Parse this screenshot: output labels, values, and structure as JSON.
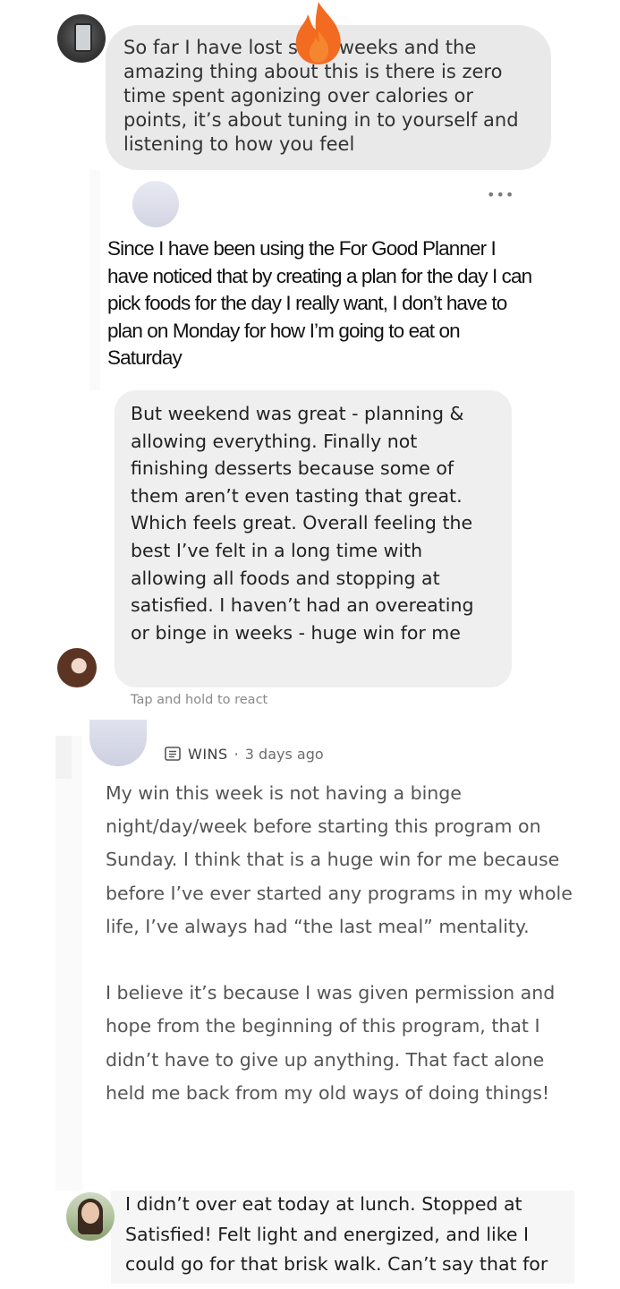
{
  "post1": {
    "text": "So far I have lost      s in 4weeks and the amazing thing about this is there is zero time spent agonizing over calories or points, it’s about tuning in to yourself and listening to how you feel",
    "emoji": "fire-icon",
    "emoji_color": "#f26b21"
  },
  "post2": {
    "more_label": "•••",
    "text": "Since I have been using the For Good Planner I have noticed that by creating a plan for the day I can pick foods for the day I really want, I don’t have to plan on Monday for how I’m going to eat on Saturday"
  },
  "post3": {
    "text": "But weekend was great - planning & allowing everything. Finally not finishing desserts because some of them aren’t even tasting that great. Which feels great. Overall feeling the best I’ve felt in a long time with allowing all foods and stopping at satisfied. I haven’t had an overeating or binge in weeks - huge win for me",
    "hint": "Tap and hold to react"
  },
  "post4": {
    "tag_icon": "list-icon",
    "tag": "WINS",
    "separator": "·",
    "time_ago": "3 days ago",
    "paragraphs": [
      "My win this week is not having a binge night/day/week before starting this program on Sunday. I think that is a huge win for me because before I’ve ever started any programs in my whole life, I’ve always had “the last meal” mentality.",
      "I believe it’s because I was given permission and hope from the beginning of this program, that I didn’t have to give up anything. That fact alone held me back from my old ways of doing things!"
    ]
  },
  "post5": {
    "text": "I didn’t over eat today at lunch. Stopped at Satisfied! Felt light and energized, and like I could go for that brisk walk. Can’t say that for"
  }
}
